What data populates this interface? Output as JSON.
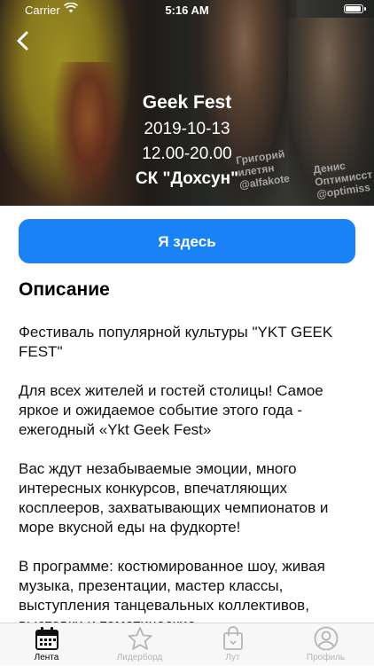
{
  "status_bar": {
    "carrier": "Carrier",
    "time": "5:16 AM"
  },
  "hero": {
    "title": "Geek Fest",
    "date": "2019-10-13",
    "time": "12.00-20.00",
    "place": "СК \"Дохсун\"",
    "tag1": "Григорий\nилетян\n@alfakote",
    "tag2": "Денис\nОптимисст\n@optimiss"
  },
  "action": {
    "here_label": "Я здесь"
  },
  "description": {
    "title": "Описание",
    "paragraphs": [
      "Фестиваль популярной культуры \"YKT GEEK FEST\"",
      "Для всех жителей и гостей столицы! Самое яркое и ожидаемое событие этого года - ежегодный «Ykt Geek Fest»",
      "Вас ждут незабываемые эмоции, много интересных конкурсов, впечатляющих косплееров, захватывающих чемпионатов и море вкусной еды на фудкорте!",
      "В программе: костюмированное шоу, живая музыка, презентации, мастер классы, выступления танцевальных коллективов, выставки и тематические"
    ]
  },
  "tabbar": {
    "tabs": [
      {
        "label": "Лента",
        "icon": "calendar-icon",
        "active": true
      },
      {
        "label": "Лидерборд",
        "icon": "star-icon",
        "active": false
      },
      {
        "label": "Лут",
        "icon": "bag-icon",
        "active": false
      },
      {
        "label": "Профиль",
        "icon": "profile-icon",
        "active": false
      }
    ]
  },
  "colors": {
    "accent": "#1a82f7",
    "tab_inactive": "#b5b5b5"
  }
}
